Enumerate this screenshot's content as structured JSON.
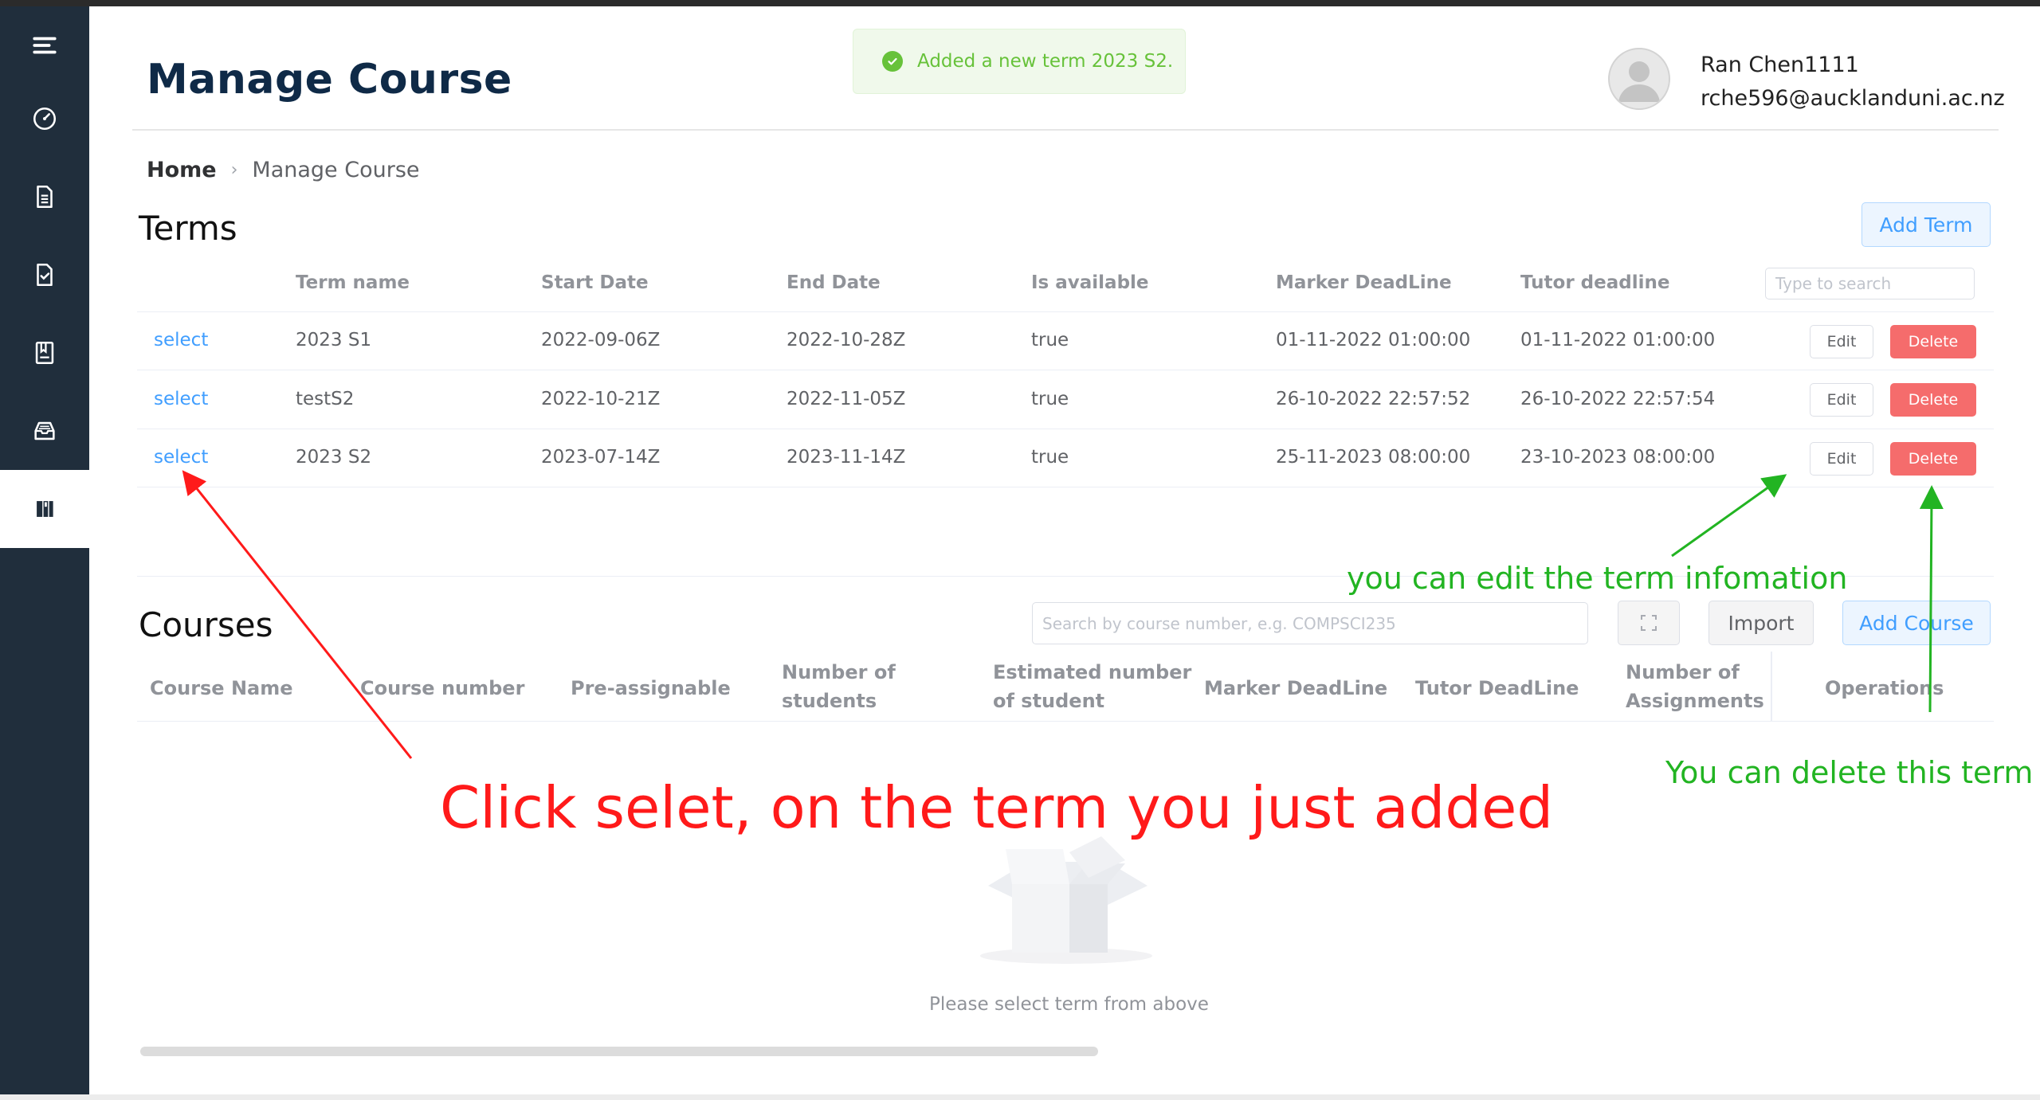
{
  "header": {
    "title": "Manage Course",
    "toast": "Added a new term 2023 S2.",
    "user_name": "Ran Chen1111",
    "user_email": "rche596@aucklanduni.ac.nz"
  },
  "breadcrumb": {
    "home": "Home",
    "current": "Manage Course"
  },
  "sidebar": {
    "items": [
      {
        "icon": "menu-icon"
      },
      {
        "icon": "dashboard-icon"
      },
      {
        "icon": "document-icon"
      },
      {
        "icon": "checklist-icon"
      },
      {
        "icon": "book-icon"
      },
      {
        "icon": "inbox-icon"
      },
      {
        "icon": "library-icon",
        "active": true
      }
    ]
  },
  "terms": {
    "title": "Terms",
    "add_button": "Add Term",
    "search_placeholder": "Type to search",
    "columns": [
      "Term name",
      "Start Date",
      "End Date",
      "Is available",
      "Marker DeadLine",
      "Tutor deadline"
    ],
    "rows": [
      {
        "select": "select",
        "name": "2023 S1",
        "start": "2022-09-06Z",
        "end": "2022-10-28Z",
        "available": "true",
        "marker": "01-11-2022 01:00:00",
        "tutor": "01-11-2022 01:00:00",
        "edit": "Edit",
        "delete": "Delete"
      },
      {
        "select": "select",
        "name": "testS2",
        "start": "2022-10-21Z",
        "end": "2022-11-05Z",
        "available": "true",
        "marker": "26-10-2022 22:57:52",
        "tutor": "26-10-2022 22:57:54",
        "edit": "Edit",
        "delete": "Delete"
      },
      {
        "select": "select",
        "name": "2023 S2",
        "start": "2023-07-14Z",
        "end": "2023-11-14Z",
        "available": "true",
        "marker": "25-11-2023 08:00:00",
        "tutor": "23-10-2023 08:00:00",
        "edit": "Edit",
        "delete": "Delete"
      }
    ]
  },
  "courses": {
    "title": "Courses",
    "search_placeholder": "Search by course number, e.g. COMPSCI235",
    "import_button": "Import",
    "add_button": "Add Course",
    "columns": [
      {
        "line1": "Course Name",
        "line2": ""
      },
      {
        "line1": "Course number",
        "line2": ""
      },
      {
        "line1": "Pre-assignable",
        "line2": ""
      },
      {
        "line1": "Number of",
        "line2": "students"
      },
      {
        "line1": "Estimated number",
        "line2": "of student"
      },
      {
        "line1": "Marker DeadLine",
        "line2": ""
      },
      {
        "line1": "Tutor DeadLine",
        "line2": ""
      },
      {
        "line1": "Number of",
        "line2": "Assignments"
      },
      {
        "line1": "Operations",
        "line2": ""
      }
    ],
    "empty_text": "Please select term from above"
  },
  "annotations": {
    "red": "Click selet, on the term you just added",
    "green_edit": "you can edit the term infomation",
    "green_delete": "You can delete this term"
  },
  "colors": {
    "sidebar": "#202e3c",
    "primary": "#409eff",
    "danger": "#f56c6c",
    "success": "#67c23a",
    "annotation_red": "#ff1a1a",
    "annotation_green": "#22b422"
  }
}
